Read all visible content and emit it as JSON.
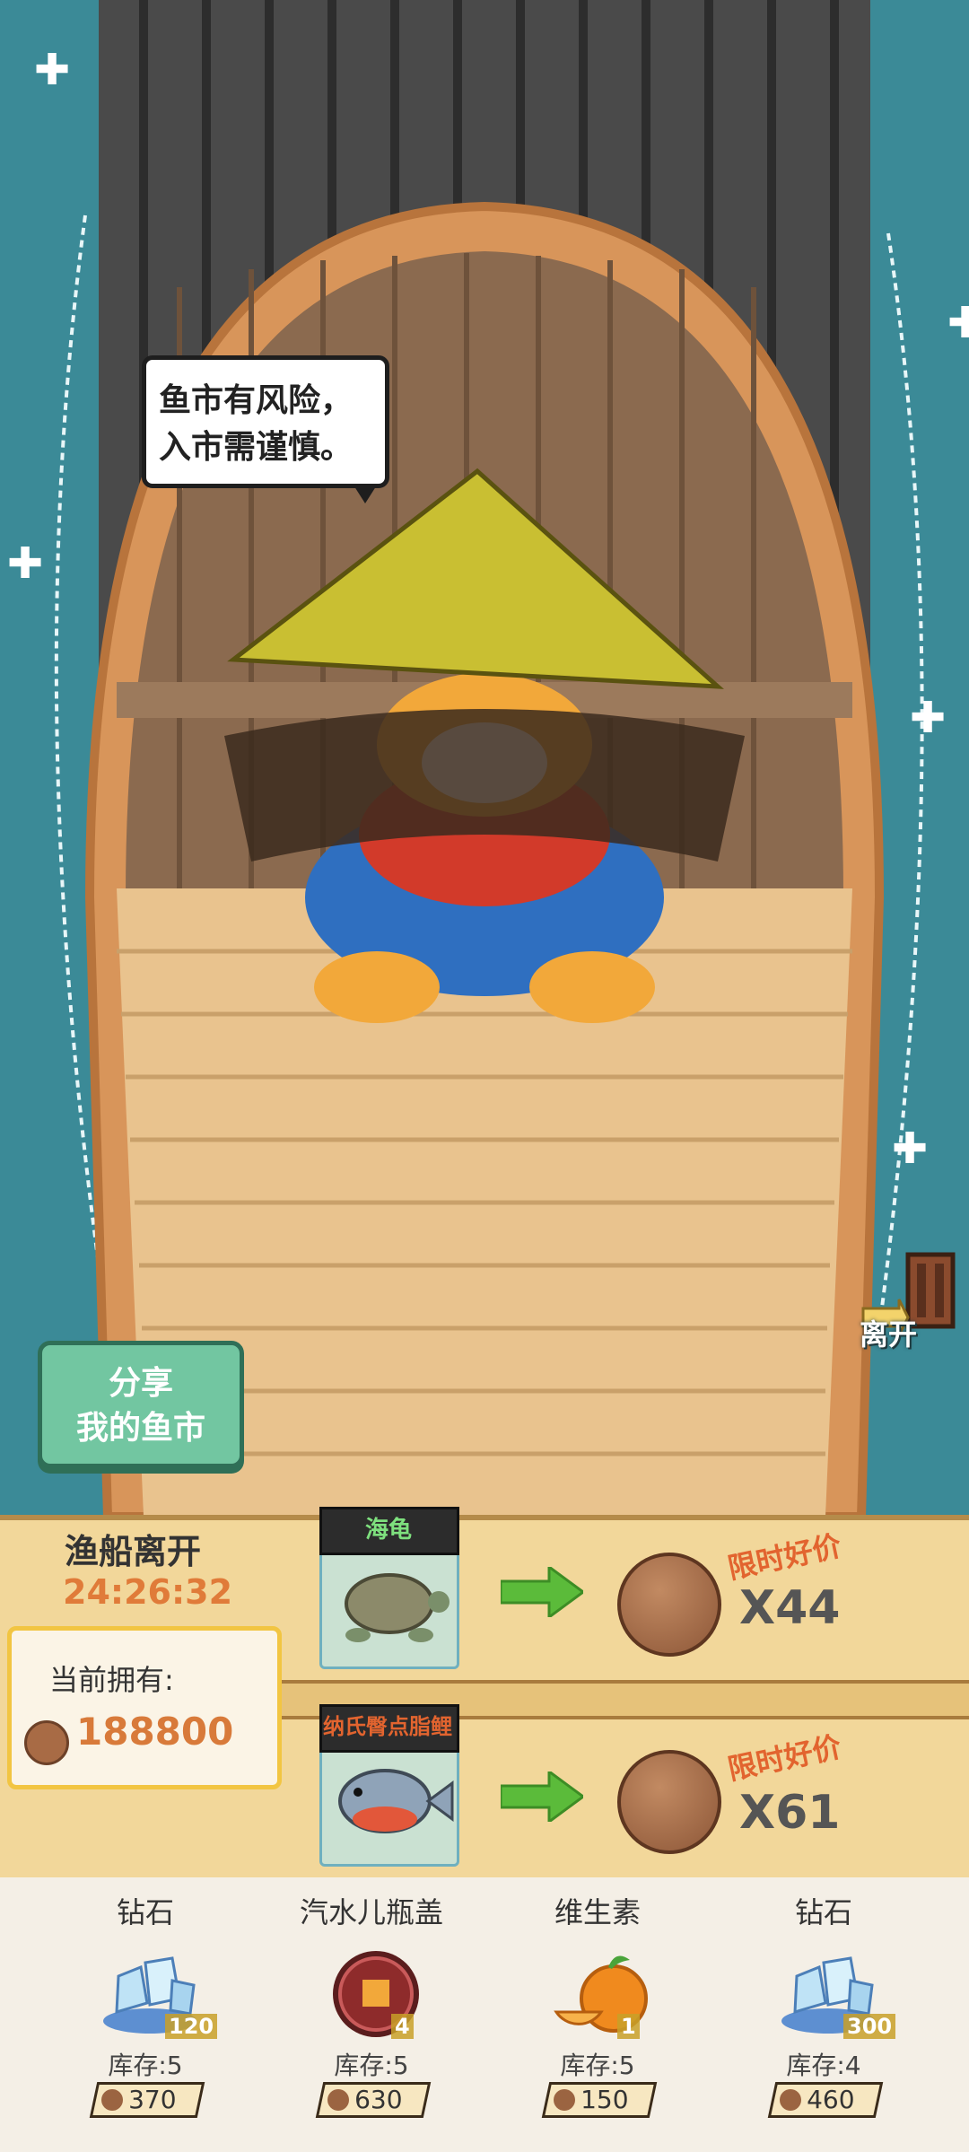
{
  "speech": {
    "line1": "鱼市有风险，",
    "line2": "入市需谨慎。"
  },
  "share_button": {
    "line1": "分享",
    "line2": "我的鱼市"
  },
  "leave_button": {
    "label": "离开"
  },
  "market": {
    "depart_title": "渔船离开",
    "timer": "24:26:32",
    "owned_label": "当前拥有:",
    "owned_amount": "188800",
    "offers": [
      {
        "fish": "海龟",
        "deal": "限时好价",
        "price": "X44"
      },
      {
        "fish": "纳氏臀点脂鲤",
        "deal": "限时好价",
        "price": "X61"
      }
    ]
  },
  "shop": [
    {
      "name": "钻石",
      "icon": "diamond-icon",
      "count": "120",
      "stock": "库存:5",
      "price": "370"
    },
    {
      "name": "汽水儿瓶盖",
      "icon": "bottle-cap-icon",
      "count": "4",
      "stock": "库存:5",
      "price": "630"
    },
    {
      "name": "维生素",
      "icon": "orange-icon",
      "count": "1",
      "stock": "库存:5",
      "price": "150"
    },
    {
      "name": "钻石",
      "icon": "diamond-icon",
      "count": "300",
      "stock": "库存:4",
      "price": "460"
    }
  ]
}
